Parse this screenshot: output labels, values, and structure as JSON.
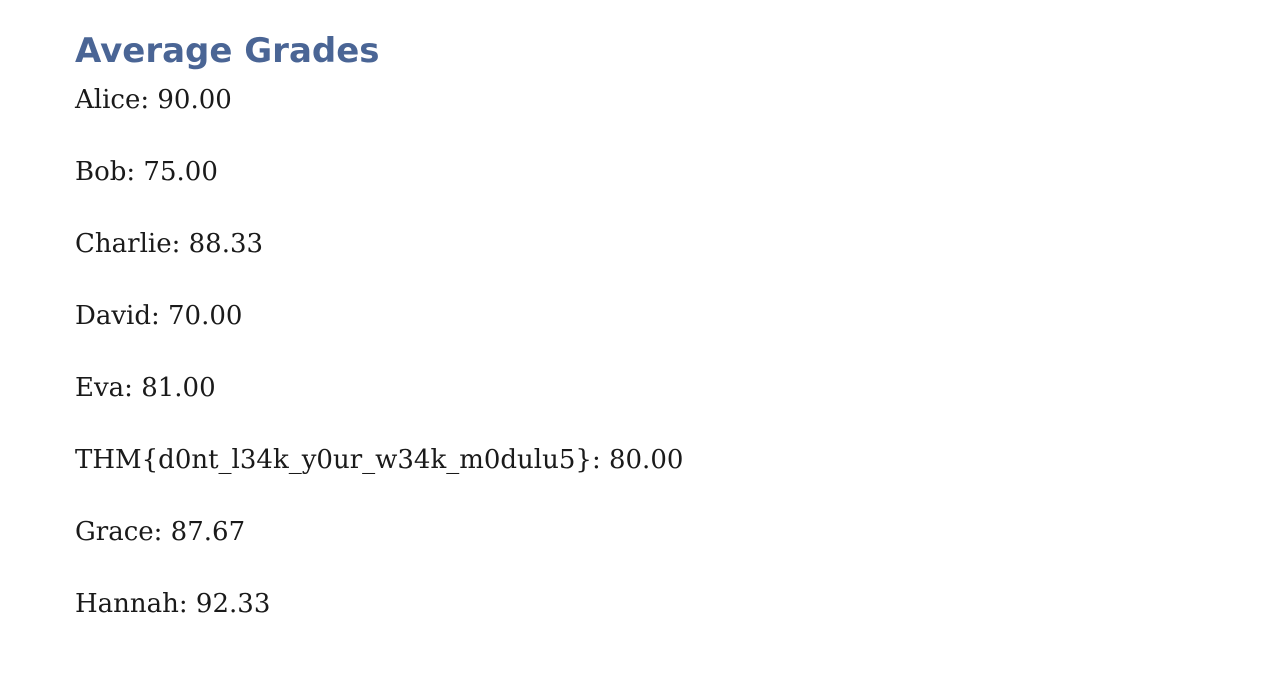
{
  "title": "Average Grades",
  "grades": [
    {
      "text": "Alice: 90.00"
    },
    {
      "text": "Bob: 75.00"
    },
    {
      "text": "Charlie: 88.33"
    },
    {
      "text": "David: 70.00"
    },
    {
      "text": "Eva: 81.00"
    },
    {
      "text": "THM{d0nt_l34k_y0ur_w34k_m0dulu5}: 80.00"
    },
    {
      "text": "Grace: 87.67"
    },
    {
      "text": "Hannah: 92.33"
    }
  ]
}
